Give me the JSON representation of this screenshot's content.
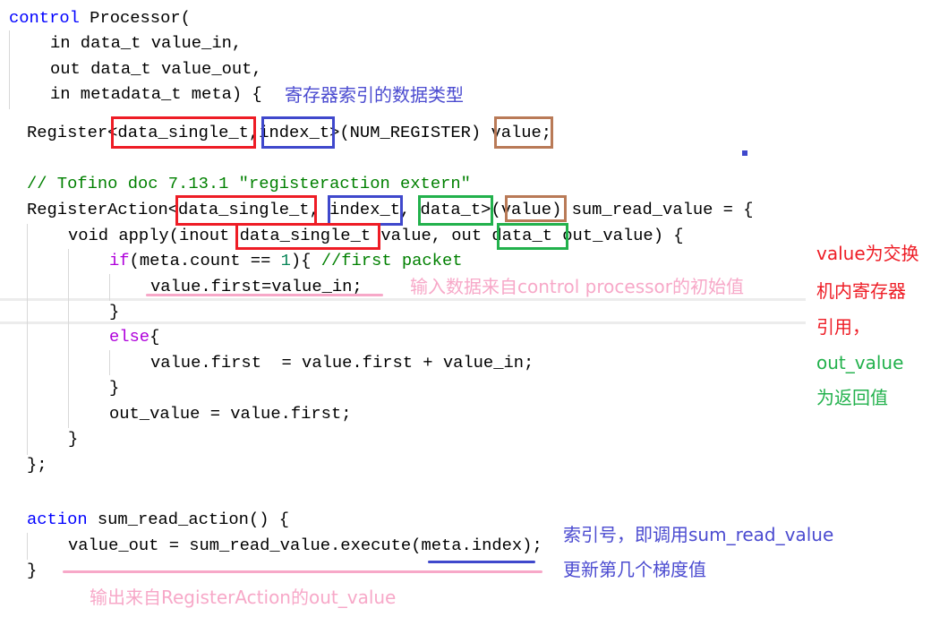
{
  "code_lines": [
    {
      "tokens": [
        [
          "control",
          "kw"
        ],
        [
          " Processor(",
          ""
        ]
      ]
    },
    {
      "tokens": [
        [
          "in data_t value_in,",
          ""
        ]
      ]
    },
    {
      "tokens": [
        [
          "out data_t value_out,",
          ""
        ]
      ]
    },
    {
      "tokens": [
        [
          "in metadata_t meta) {",
          ""
        ]
      ]
    },
    {
      "tokens": [
        [
          "Register<data_single_t,index_t>(NUM_REGISTER) value;",
          ""
        ]
      ]
    },
    {
      "tokens": [
        [
          "// Tofino doc 7.13.1 \"registeraction extern\"",
          "cm"
        ]
      ]
    },
    {
      "tokens": [
        [
          "RegisterAction<data_single_t, index_t, data_t>(value) sum_read_value = {",
          ""
        ]
      ]
    },
    {
      "tokens": [
        [
          "void apply(inout data_single_t value, out data_t out_value) {",
          ""
        ]
      ]
    },
    {
      "tokens": [
        [
          "if",
          "ctl"
        ],
        [
          "(meta.count == ",
          ""
        ],
        [
          "1",
          "num"
        ],
        [
          "){ ",
          ""
        ],
        [
          "//first packet",
          "cm"
        ]
      ]
    },
    {
      "tokens": [
        [
          "value.first=value_in;",
          ""
        ]
      ]
    },
    {
      "tokens": [
        [
          "}",
          ""
        ]
      ]
    },
    {
      "tokens": [
        [
          "else",
          "ctl"
        ],
        [
          "{",
          ""
        ]
      ]
    },
    {
      "tokens": [
        [
          "value.first  = value.first + value_in;",
          ""
        ]
      ]
    },
    {
      "tokens": [
        [
          "}",
          ""
        ]
      ]
    },
    {
      "tokens": [
        [
          "out_value = value.first;",
          ""
        ]
      ]
    },
    {
      "tokens": [
        [
          "}",
          ""
        ]
      ]
    },
    {
      "tokens": [
        [
          "};",
          ""
        ]
      ]
    },
    {
      "tokens": [
        [
          "action",
          "kw"
        ],
        [
          " sum_read_action() {",
          ""
        ]
      ]
    },
    {
      "tokens": [
        [
          "value_out = sum_read_value.execute(meta.index);",
          ""
        ]
      ]
    },
    {
      "tokens": [
        [
          "}",
          ""
        ]
      ]
    }
  ],
  "annotations": {
    "register_index_type": "寄存器索引的数据类型",
    "input_source": "输入数据来自control processor的初始值",
    "value_note": [
      "value为交换",
      "机内寄存器",
      "引用，"
    ],
    "out_value_note": [
      "out_value",
      "为返回值"
    ],
    "index_note": [
      "索引号，即调用sum_read_value",
      "更新第几个梯度值"
    ],
    "output_source": "输出来自RegisterAction的out_value"
  },
  "colors": {
    "red_box": "#ee1c25",
    "blue_box": "#3f48cc",
    "brown_box": "#b97a57",
    "green_box": "#22b14c",
    "pink": "#f7a8c8",
    "note_blue": "#4b4bd0",
    "note_red": "#ee1c25",
    "note_green": "#22b14c"
  }
}
